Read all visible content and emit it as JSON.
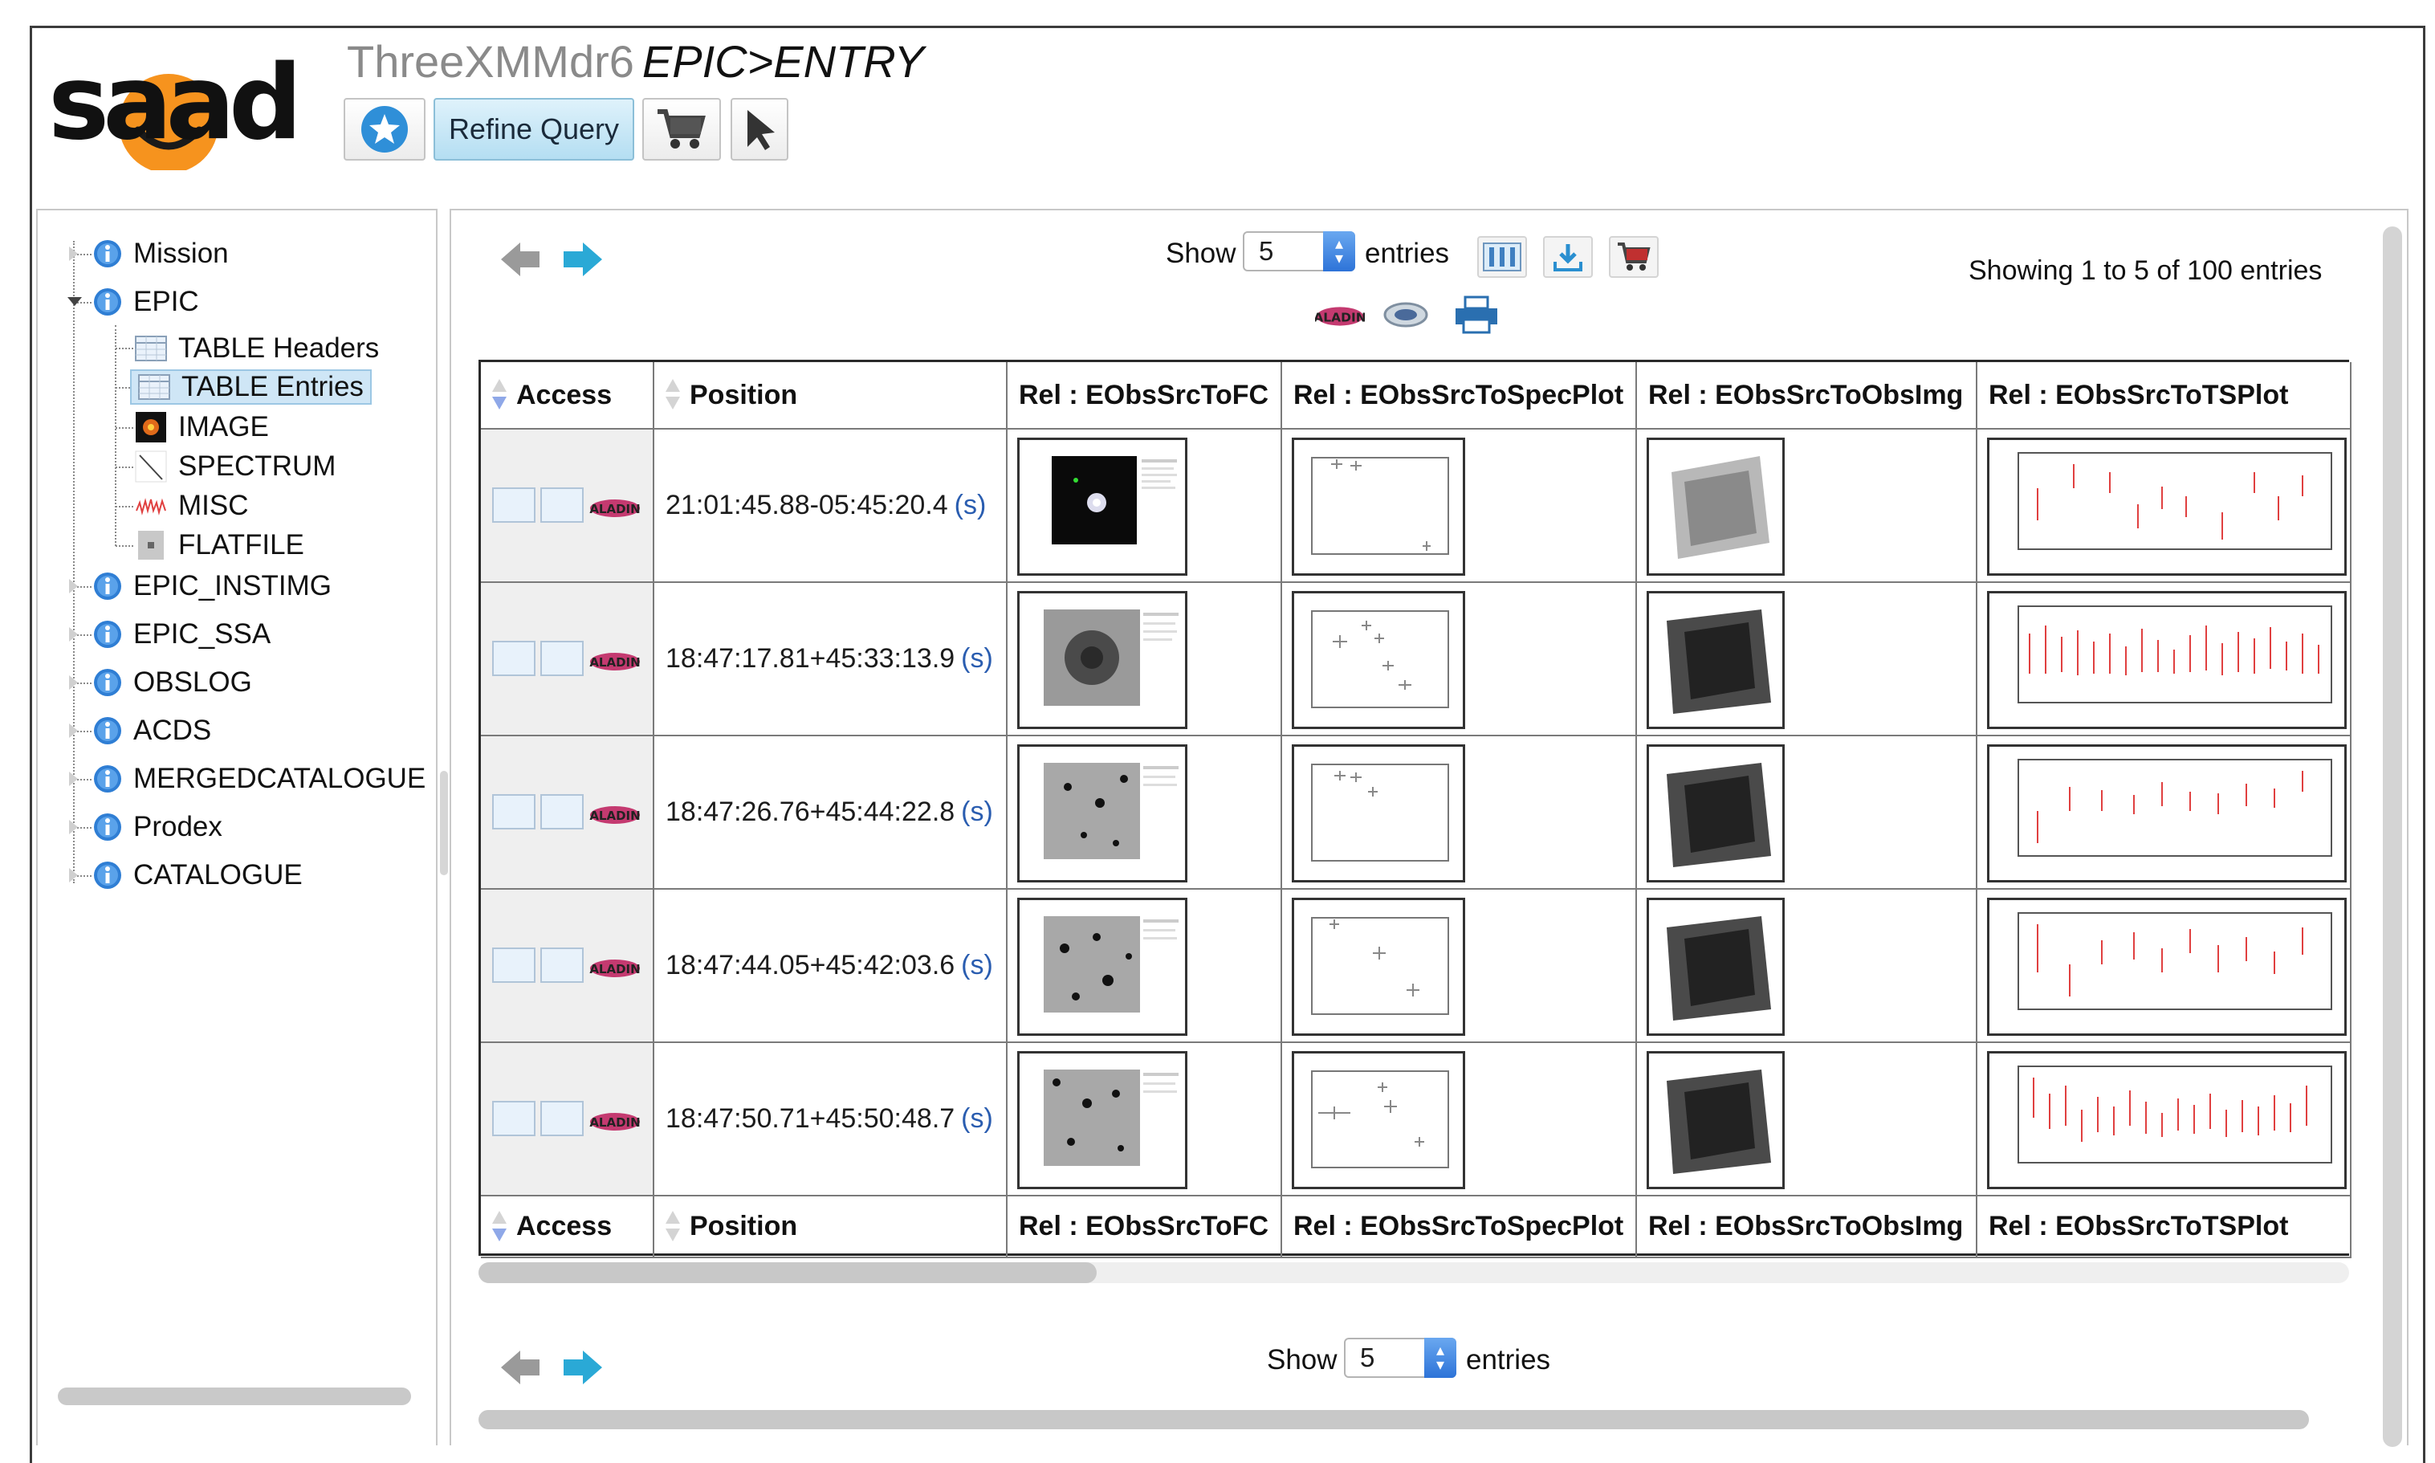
{
  "header": {
    "logo_text": "saada",
    "database_name": "ThreeXMMdr6",
    "class_path": "EPIC>ENTRY",
    "refine_query_label": "Refine Query"
  },
  "tree": {
    "items": [
      {
        "label": "Mission",
        "icon": "info-icon"
      },
      {
        "label": "EPIC",
        "icon": "info-icon",
        "expanded": true
      },
      {
        "label": "TABLE Headers",
        "icon": "table-icon"
      },
      {
        "label": "TABLE Entries",
        "icon": "table-icon",
        "selected": true
      },
      {
        "label": "IMAGE",
        "icon": "image-icon"
      },
      {
        "label": "SPECTRUM",
        "icon": "spectrum-icon"
      },
      {
        "label": "MISC",
        "icon": "misc-icon"
      },
      {
        "label": "FLATFILE",
        "icon": "flatfile-icon"
      },
      {
        "label": "EPIC_INSTIMG",
        "icon": "info-icon"
      },
      {
        "label": "EPIC_SSA",
        "icon": "info-icon"
      },
      {
        "label": "OBSLOG",
        "icon": "info-icon"
      },
      {
        "label": "ACDS",
        "icon": "info-icon"
      },
      {
        "label": "MERGEDCATALOGUE",
        "icon": "info-icon"
      },
      {
        "label": "Prodex",
        "icon": "info-icon"
      },
      {
        "label": "CATALOGUE",
        "icon": "info-icon"
      }
    ]
  },
  "controls": {
    "show_label": "Show",
    "entries_label": "entries",
    "page_size": "5",
    "info": "Showing 1 to 5 of 100 entries",
    "aladin_label": "ALADIN"
  },
  "table": {
    "columns": [
      "Access",
      "Position",
      "Rel : EObsSrcToFC",
      "Rel : EObsSrcToSpecPlot",
      "Rel : EObsSrcToObsImg",
      "Rel : EObsSrcToTSPlot"
    ],
    "rows": [
      {
        "position": "21:01:45.88-05:45:20.4",
        "s": "(s)"
      },
      {
        "position": "18:47:17.81+45:33:13.9",
        "s": "(s)"
      },
      {
        "position": "18:47:26.76+45:44:22.8",
        "s": "(s)"
      },
      {
        "position": "18:47:44.05+45:42:03.6",
        "s": "(s)"
      },
      {
        "position": "18:47:50.71+45:50:48.7",
        "s": "(s)"
      }
    ]
  },
  "colors": {
    "accent_blue": "#2f8fd8",
    "arrow_cyan": "#2aa9d6",
    "selection_bg": "#cfe6f6",
    "plot_red": "#e04040"
  }
}
